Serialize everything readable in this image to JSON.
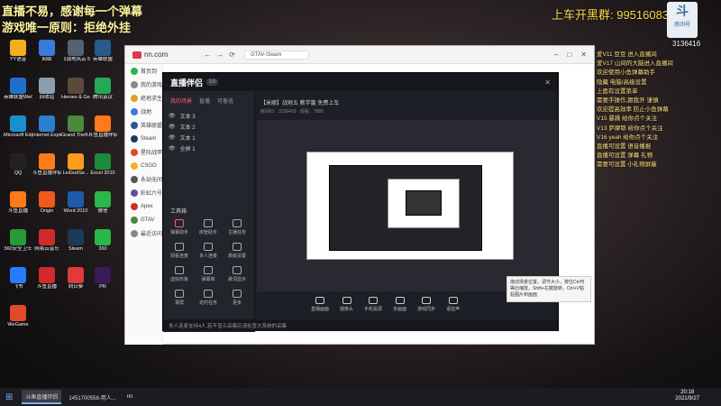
{
  "overlay": {
    "line1": "直播不易，感谢每一个弹幕",
    "line2": "游戏唯一原则：拒绝外挂",
    "group": "上车开黑群: 995160832",
    "room_logo": "斗",
    "room_label": "房间号",
    "room_number": "3136416",
    "chat": [
      "爱V11 豆豆 进入直播间",
      "爱V17 山间的大脑进入直播间",
      "欢迎使用小鱼弹幕助手",
      "隐藏 电脑/高级设置",
      "上面有设置菜单",
      "需要手操作,跟我开 谨慎",
      "欢迎提高效率 防止小鱼弹幕",
      "V15 暴躁 给你点个关注",
      "V13 萨摩耶 给你点个关注",
      "V16 yeah 给你点个关注",
      "直播可设置 语音播报",
      "直播可设置 弹幕 礼物",
      "需要可设置 小礼物屏蔽"
    ]
  },
  "desktop_icons": [
    {
      "name": "YY语音",
      "color": "#f0b020"
    },
    {
      "name": "网络",
      "color": "#3a7bd5"
    },
    {
      "name": "《战地风云 5",
      "color": "#556070"
    },
    {
      "name": "英雄联盟",
      "color": "#2a5a8a"
    },
    {
      "name": "英雄联盟WeGame版",
      "color": "#1e6fd0"
    },
    {
      "name": "回收站",
      "color": "#8aa0b0"
    },
    {
      "name": "Heroes & Generals",
      "color": "#5a4a3a"
    },
    {
      "name": "腾讯会议",
      "color": "#22aa55"
    },
    {
      "name": "Microsoft Edge",
      "color": "#1890d0"
    },
    {
      "name": "Internet Explorer",
      "color": "#2a80d0"
    },
    {
      "name": "Grand Theft Auto V",
      "color": "#4a8a3a"
    },
    {
      "name": "斗鱼直播伴侣",
      "color": "#ff7a1a"
    },
    {
      "name": "QQ",
      "color": "#222222"
    },
    {
      "name": "斗鱼直播伴侣",
      "color": "#ff7a1a"
    },
    {
      "name": "LeiGodSe...",
      "color": "#ff9a1a"
    },
    {
      "name": "Excel 2010",
      "color": "#1e8a3a"
    },
    {
      "name": "斗鱼直播",
      "color": "#ff7a1a"
    },
    {
      "name": "Origin",
      "color": "#f05a1a"
    },
    {
      "name": "Word 2010",
      "color": "#1e5aaa"
    },
    {
      "name": "微信",
      "color": "#2ab84a"
    },
    {
      "name": "360安全卫士",
      "color": "#2a9a3a"
    },
    {
      "name": "网易云音乐",
      "color": "#d22a2a"
    },
    {
      "name": "Steam",
      "color": "#1a3a5a"
    },
    {
      "name": "360",
      "color": "#2ab84a"
    },
    {
      "name": "飞书",
      "color": "#2a7aff"
    },
    {
      "name": "斗鱼直播",
      "color": "#d22a2a"
    },
    {
      "name": "向日葵",
      "color": "#e03a3a"
    },
    {
      "name": "PR",
      "color": "#3a1a5a"
    },
    {
      "name": "WeGame",
      "color": "#e04a2a"
    }
  ],
  "browser": {
    "tab_label": "GTAV-Steam",
    "addr": "nn.com",
    "sidebar": [
      "首页到",
      "我的游戏",
      "绝地求生",
      "战地",
      "英雄联盟",
      "Steam",
      "星际战甲",
      "CSGO",
      "永劫无间",
      "彩虹六号",
      "Apex",
      "GTAV",
      "最近访问"
    ]
  },
  "app": {
    "title": "直播伴侣",
    "badge": "2.0",
    "tabs": [
      "我的场景",
      "直播",
      "可备选"
    ],
    "scenes": [
      "文本 3",
      "文本 2",
      "文本 1",
      "全屏 1"
    ],
    "workbench": "工具箱",
    "tools": [
      "弹幕助手",
      "房管助手",
      "主播任务",
      "观看连麦",
      "多人连麦",
      "高级设置",
      "虚拟形象",
      "弹幕库",
      "歌词显示",
      "录屏",
      "定时任务",
      "更多"
    ],
    "header_line1": "【米娜】战地五 教学篇 免费上车",
    "header_line2": "房间ID：3136416 · 观看：7880",
    "bottom": [
      "直播画面",
      "摄像头",
      "手机投屏",
      "多画面",
      "游戏同步",
      "语音声"
    ],
    "status": "多人连麦支持4人,若不显示采集区请检查大系统的采集",
    "tooltip": "拖动场景位置，调节大小，按住Ctrl可等比缩放，Shift+右键旋转，Ctrl+V粘贴图片到画面"
  },
  "taskbar": {
    "items": [
      "斗鱼直播伴侣",
      "1451700558-用人...",
      "nn"
    ],
    "time": "20:18",
    "date": "2021/9/27"
  }
}
